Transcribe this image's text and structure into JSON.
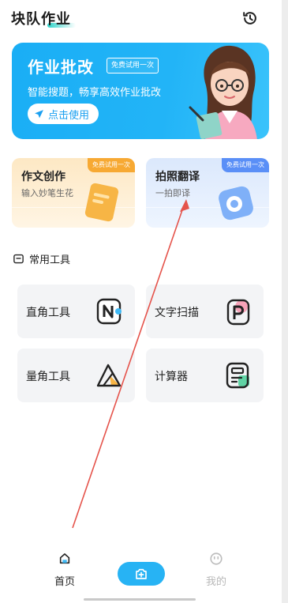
{
  "app": {
    "title": "块队作业"
  },
  "banner": {
    "title": "作业批改",
    "badge": "免费试用一次",
    "subtitle": "智能搜题，畅享高效作业批改",
    "button_label": "点击使用"
  },
  "cards": [
    {
      "title": "作文创作",
      "subtitle": "输入妙笔生花",
      "badge": "免费试用一次"
    },
    {
      "title": "拍照翻译",
      "subtitle": "一拍即译",
      "badge": "免费试用一次"
    }
  ],
  "tools_section": {
    "title": "常用工具",
    "items": [
      {
        "label": "直角工具"
      },
      {
        "label": "文字扫描"
      },
      {
        "label": "量角工具"
      },
      {
        "label": "计算器"
      }
    ]
  },
  "bottom_nav": {
    "home_label": "首页",
    "mine_label": "我的"
  },
  "colors": {
    "accent_blue": "#27b3f4",
    "badge_orange": "#f7a933",
    "badge_blue": "#5a8ff7",
    "annotation_red": "#e5534b"
  }
}
